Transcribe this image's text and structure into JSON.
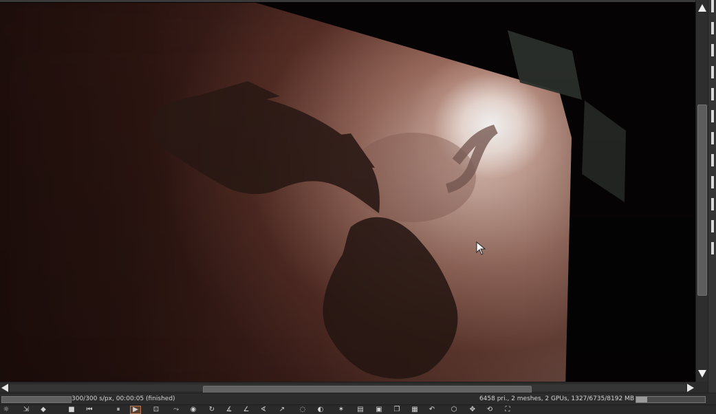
{
  "render": {
    "status_text": "300/300 s/px, 00:00:05 (finished)",
    "stats_text": "6458 pri., 2 meshes, 2 GPUs, 1327/6735/8192 MB",
    "progress_fraction": 1.0,
    "memory_fraction": 0.16
  },
  "colors": {
    "background": "#050303",
    "highlight": "#fff7f3",
    "accent": "#b8794e"
  },
  "toolbar": {
    "items": [
      {
        "name": "render-settings-icon",
        "glyph": "☼"
      },
      {
        "name": "move-icon",
        "glyph": "⇲"
      },
      {
        "name": "layer-icon",
        "glyph": "◆"
      },
      {
        "name": "stop-icon",
        "glyph": "■"
      },
      {
        "name": "rewind-icon",
        "glyph": "⏮"
      },
      {
        "name": "pause-icon",
        "glyph": "⏸"
      },
      {
        "name": "play-icon",
        "glyph": "▶"
      },
      {
        "name": "region-icon",
        "glyph": "⊡"
      },
      {
        "name": "curve-icon-1",
        "glyph": "⤳"
      },
      {
        "name": "camera-icon",
        "glyph": "◉"
      },
      {
        "name": "rotate-icon",
        "glyph": "↻"
      },
      {
        "name": "axis-icon-1",
        "glyph": "∡"
      },
      {
        "name": "axis-icon-2",
        "glyph": "∠"
      },
      {
        "name": "axis-icon-3",
        "glyph": "∢"
      },
      {
        "name": "axis-icon-4",
        "glyph": "↗"
      },
      {
        "name": "globe-icon",
        "glyph": "◌"
      },
      {
        "name": "contrast-icon",
        "glyph": "◐"
      },
      {
        "name": "sun-icon",
        "glyph": "✶"
      },
      {
        "name": "clipboard-icon",
        "glyph": "▤"
      },
      {
        "name": "image-icon",
        "glyph": "▣"
      },
      {
        "name": "copy-icon",
        "glyph": "❐"
      },
      {
        "name": "checker-icon",
        "glyph": "▦"
      },
      {
        "name": "undo-icon",
        "glyph": "↶"
      },
      {
        "name": "cube-icon",
        "glyph": "⬡"
      },
      {
        "name": "pan-icon",
        "glyph": "✥"
      },
      {
        "name": "orbit-icon",
        "glyph": "⟲"
      },
      {
        "name": "fullscreen-icon",
        "glyph": "⛶"
      }
    ]
  }
}
